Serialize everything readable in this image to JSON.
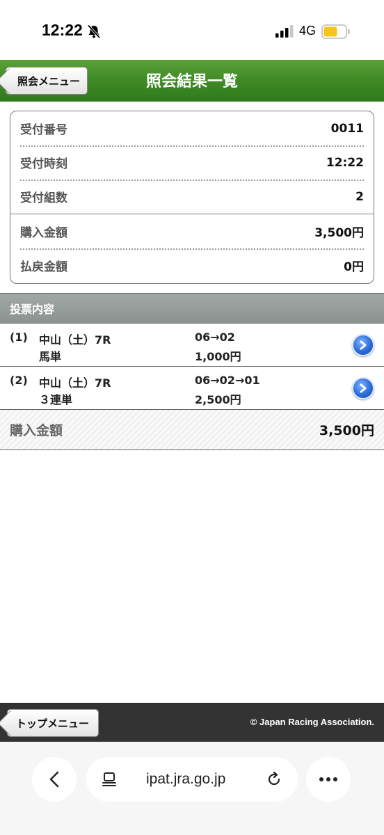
{
  "status_bar": {
    "time": "12:22",
    "network": "4G"
  },
  "header": {
    "back_button": "照会メニュー",
    "title": "照会結果一覧"
  },
  "summary": {
    "receipt_number": {
      "label": "受付番号",
      "value": "0011"
    },
    "receipt_time": {
      "label": "受付時刻",
      "value": "12:22"
    },
    "receipt_count": {
      "label": "受付組数",
      "value": "2"
    },
    "purchase_amount": {
      "label": "購入金額",
      "value": "3,500円"
    },
    "refund_amount": {
      "label": "払戻金額",
      "value": "0円"
    }
  },
  "bets_section": {
    "title": "投票内容",
    "bets": [
      {
        "no": "(1)",
        "race": "中山（土）7R",
        "type": "馬単",
        "combination": "06→02",
        "amount": "1,000円"
      },
      {
        "no": "(2)",
        "race": "中山（土）7R",
        "type": "３連単",
        "combination": "06→02→01",
        "amount": "2,500円"
      }
    ]
  },
  "total": {
    "label": "購入金額",
    "value": "3,500円"
  },
  "footer": {
    "top_menu_button": "トップメニュー",
    "copyright": "© Japan Racing Association."
  },
  "browser": {
    "url": "ipat.jra.go.jp"
  },
  "colors": {
    "header_green": "#3f8a25",
    "section_gray": "#9a9f9d",
    "footer_dark": "#333333",
    "arrow_blue": "#2a6bd8"
  }
}
